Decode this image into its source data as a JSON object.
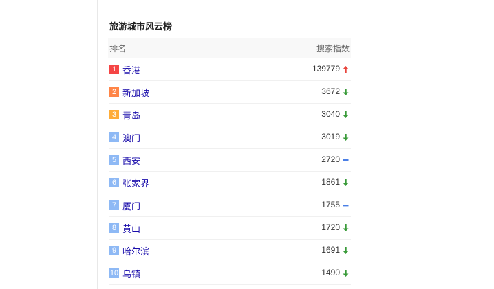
{
  "panel": {
    "title": "旅游城市风云榜",
    "header": {
      "rank_label": "排名",
      "value_label": "搜索指数"
    },
    "items": [
      {
        "rank": "1",
        "name": "香港",
        "value": "139779",
        "trend": "up"
      },
      {
        "rank": "2",
        "name": "新加坡",
        "value": "3672",
        "trend": "down"
      },
      {
        "rank": "3",
        "name": "青岛",
        "value": "3040",
        "trend": "down"
      },
      {
        "rank": "4",
        "name": "澳门",
        "value": "3019",
        "trend": "down"
      },
      {
        "rank": "5",
        "name": "西安",
        "value": "2720",
        "trend": "flat"
      },
      {
        "rank": "6",
        "name": "张家界",
        "value": "1861",
        "trend": "down"
      },
      {
        "rank": "7",
        "name": "厦门",
        "value": "1755",
        "trend": "flat"
      },
      {
        "rank": "8",
        "name": "黄山",
        "value": "1720",
        "trend": "down"
      },
      {
        "rank": "9",
        "name": "哈尔滨",
        "value": "1691",
        "trend": "down"
      },
      {
        "rank": "10",
        "name": "乌镇",
        "value": "1490",
        "trend": "down"
      }
    ]
  },
  "colors": {
    "up": "#e8453c",
    "down": "#3a9b3a",
    "flat": "#4a7fe6",
    "link": "#1a0dab"
  },
  "icons": {
    "up": "arrow-up-icon",
    "down": "arrow-down-icon",
    "flat": "dash-icon"
  }
}
